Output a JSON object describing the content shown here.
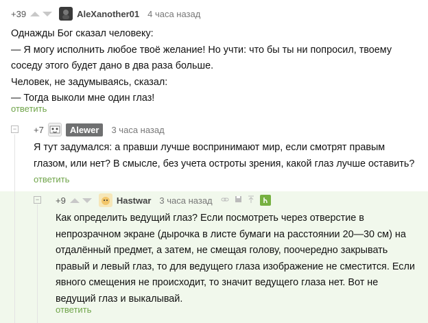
{
  "comments": [
    {
      "rating": "+39",
      "username": "AleXanother01",
      "time": "4 часа назад",
      "lines": [
        "Однажды Бог сказал человеку:",
        "— Я могу исполнить любое твоё желание! Но учти: что бы ты ни попросил, твоему",
        "соседу этого будет дано в два раза больше.",
        "Человек, не задумываясь, сказал:",
        "— Тогда выколи мне один глаз!"
      ],
      "reply": "ответить"
    },
    {
      "rating": "+7",
      "username": "Alewer",
      "time": "3 часа назад",
      "lines": [
        "Я тут задумался: а правши лучше воспринимают мир, если смотрят правым",
        "глазом, или нет? В смысле, без учета остроты зрения, какой глаз лучше оставить?"
      ],
      "reply": "ответить"
    },
    {
      "rating": "+9",
      "username": "Hastwar",
      "time": "3 часа назад",
      "lines": [
        "Как определить ведущий глаз? Если посмотреть через отверстие в",
        "непрозрачном экране (дырочка в листе бумаги на расстоянии 20—30 см) на",
        "отдалённый предмет, а затем, не смещая голову, поочередно закрывать",
        "правый и левый глаз, то для ведущего глаза изображение не сместится. Если",
        "явного смещения не происходит, то значит ведущего глаза нет. Вот не",
        "ведущий глаз и выкалывай."
      ],
      "reply": "ответить"
    }
  ],
  "collapse_symbol": "−",
  "colors": {
    "reply": "#6fa449",
    "highlight": "#f1f8ec",
    "badge": "#6f7071",
    "green_button": "#76b041"
  }
}
